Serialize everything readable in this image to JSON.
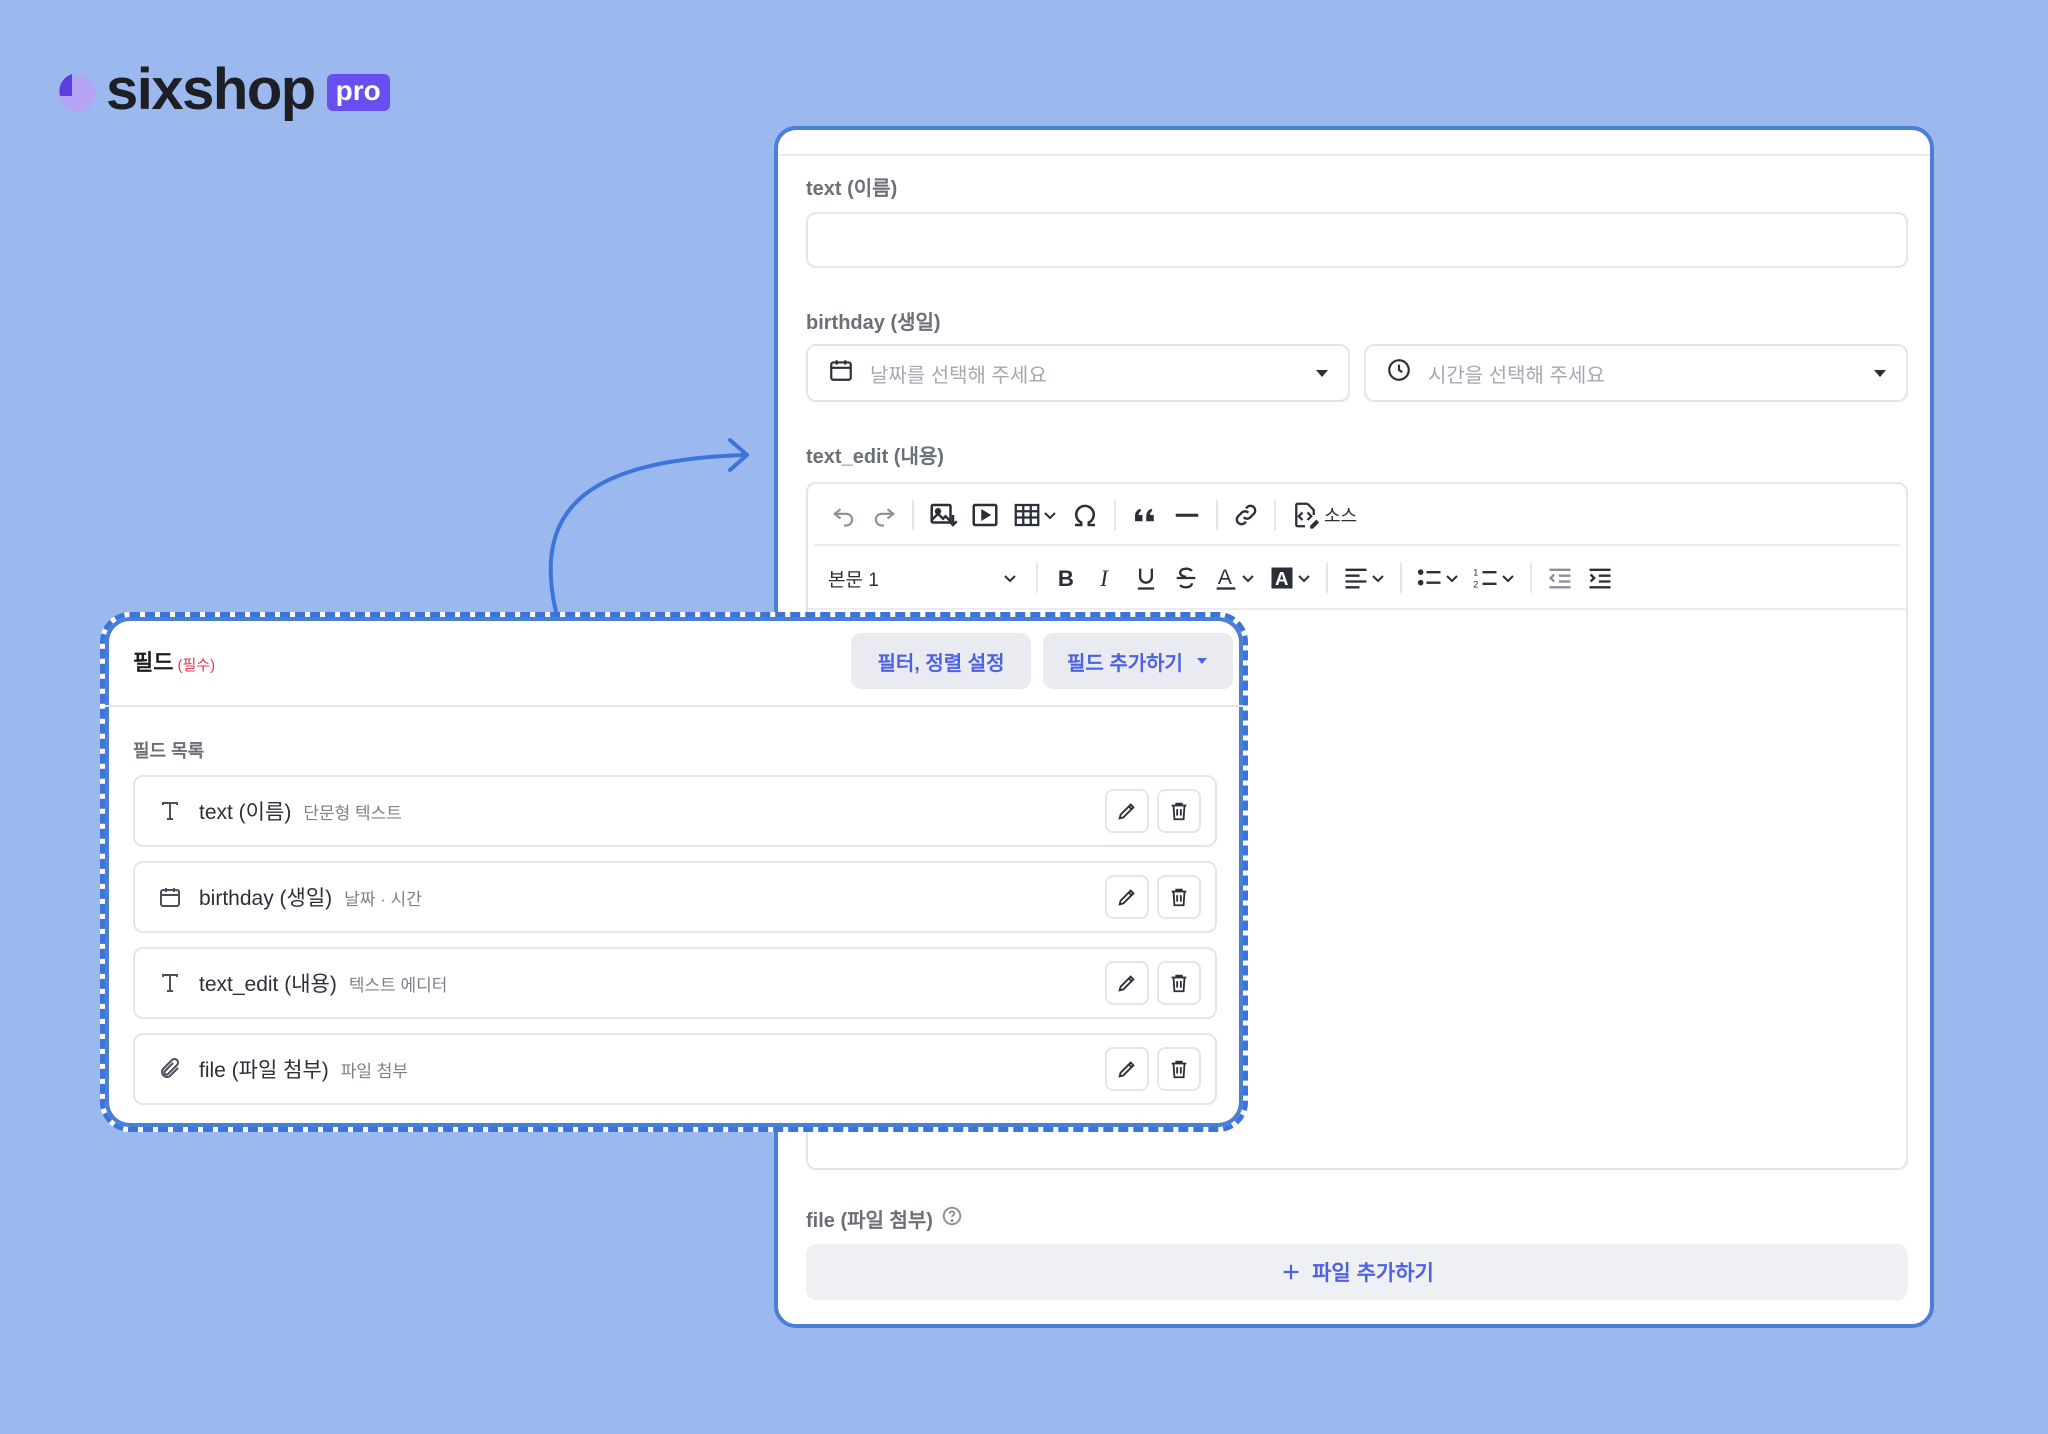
{
  "brand": {
    "name": "sixshop",
    "badge": "pro",
    "colors": {
      "accent": "#6a4ff0",
      "link": "#4d62e0",
      "background": "#9bb9ee",
      "frame": "#4a7fd6"
    }
  },
  "form": {
    "text_label": "text (이름)",
    "text_value": "",
    "birthday_label": "birthday (생일)",
    "date_placeholder": "날짜를 선택해 주세요",
    "time_placeholder": "시간을 선택해 주세요",
    "text_edit_label": "text_edit (내용)",
    "editor": {
      "toolbar_row1": [
        "undo-icon",
        "redo-icon",
        "image-icon",
        "video-icon",
        "table-icon",
        "omega-icon",
        "quote-icon",
        "horizontal-line-icon",
        "link-icon",
        "source-icon"
      ],
      "source_label": "소스",
      "style_select": "본문 1",
      "toolbar_row2": [
        "bold-icon",
        "italic-icon",
        "underline-icon",
        "strikethrough-icon",
        "font-color-icon",
        "highlight-icon",
        "align-icon",
        "bullet-list-icon",
        "numbered-list-icon",
        "outdent-icon",
        "indent-icon"
      ]
    },
    "file_label": "file (파일 첨부)",
    "file_button": "파일 추가하기"
  },
  "fields_card": {
    "title": "필드",
    "required": "(필수)",
    "filter_button": "필터, 정렬 설정",
    "add_button": "필드 추가하기",
    "list_title": "필드 목록",
    "rows": [
      {
        "icon": "text-type-icon",
        "name": "text (이름)",
        "type": "단문형 텍스트"
      },
      {
        "icon": "calendar-icon",
        "name": "birthday (생일)",
        "type": "날짜 · 시간"
      },
      {
        "icon": "text-type-icon",
        "name": "text_edit (내용)",
        "type": "텍스트 에디터"
      },
      {
        "icon": "paperclip-icon",
        "name": "file (파일 첨부)",
        "type": "파일 첨부"
      }
    ]
  }
}
